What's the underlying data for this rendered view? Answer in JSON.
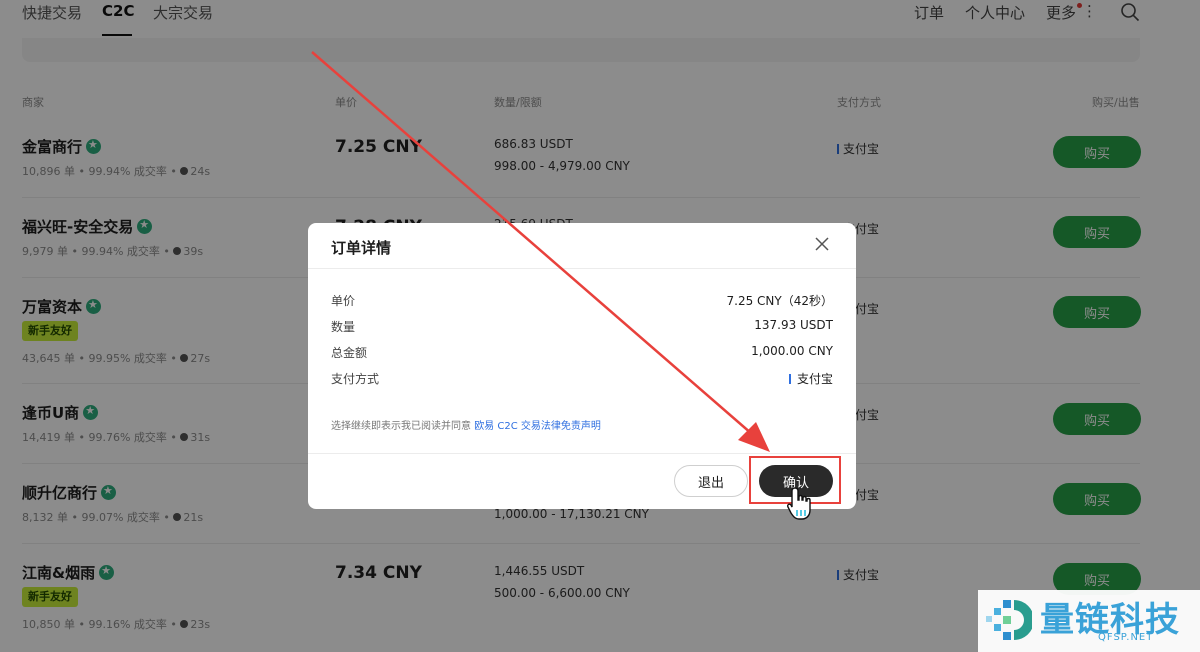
{
  "nav": {
    "tabs": [
      "快捷交易",
      "C2C",
      "大宗交易"
    ],
    "right": [
      "订单",
      "个人中心",
      "更多"
    ]
  },
  "table": {
    "headers": [
      "商家",
      "单价",
      "数量/限额",
      "支付方式",
      "购买/出售"
    ],
    "rows": [
      {
        "name": "金富商行",
        "tag": "",
        "stats": "10,896 单 • 99.94% 成交率 •",
        "time": "24s",
        "price": "7.25 CNY",
        "qty": "686.83 USDT",
        "limit": "998.00 - 4,979.00 CNY",
        "pay": "支付宝",
        "btn": "购买"
      },
      {
        "name": "福兴旺-安全交易",
        "tag": "",
        "stats": "9,979 单 • 99.94% 成交率 •",
        "time": "39s",
        "price": "7.28 CNY",
        "qty": "215.69 USDT",
        "limit": "",
        "pay": "支付宝",
        "btn": "购买"
      },
      {
        "name": "万富资本",
        "tag": "新手友好",
        "stats": "43,645 单 • 99.95% 成交率 •",
        "time": "27s",
        "price": "",
        "qty": "",
        "limit": "",
        "pay": "支付宝",
        "btn": "购买"
      },
      {
        "name": "逢币U商",
        "tag": "",
        "stats": "14,419 单 • 99.76% 成交率 •",
        "time": "31s",
        "price": "",
        "qty": "",
        "limit": "",
        "pay": "支付宝",
        "btn": "购买"
      },
      {
        "name": "顺升亿商行",
        "tag": "",
        "stats": "8,132 单 • 99.07% 成交率 •",
        "time": "21s",
        "price": "",
        "qty": "",
        "limit": "1,000.00 - 17,130.21 CNY",
        "pay": "支付宝",
        "btn": "购买"
      },
      {
        "name": "江南&烟雨",
        "tag": "新手友好",
        "stats": "10,850 单 • 99.16% 成交率 •",
        "time": "23s",
        "price": "7.34 CNY",
        "qty": "1,446.55 USDT",
        "limit": "500.00 - 6,600.00 CNY",
        "pay": "支付宝",
        "btn": "购买"
      }
    ]
  },
  "modal": {
    "title": "订单详情",
    "details": [
      {
        "label": "单价",
        "value": "7.25 CNY（42秒）"
      },
      {
        "label": "数量",
        "value": "137.93 USDT"
      },
      {
        "label": "总金额",
        "value": "1,000.00 CNY"
      },
      {
        "label": "支付方式",
        "value": "支付宝"
      }
    ],
    "agree_text": "选择继续即表示我已阅读并同意",
    "agree_link": "欧易 C2C 交易法律免责声明",
    "exit_label": "退出",
    "confirm_label": "确认"
  },
  "watermark": {
    "text": "量链科技",
    "sub": "QFSP.NET"
  },
  "colors": {
    "buy": "#27a048",
    "highlight": "#e8413c",
    "link": "#2f6fe0",
    "confirm": "#2a2a2a"
  }
}
